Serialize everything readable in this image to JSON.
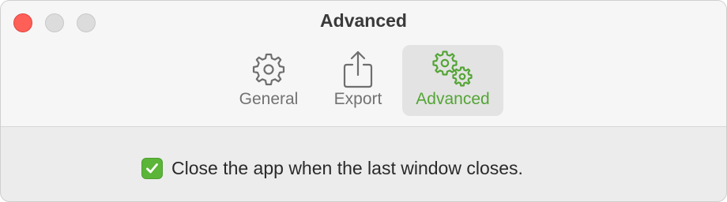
{
  "window": {
    "title": "Advanced"
  },
  "tabs": [
    {
      "label": "General",
      "icon": "gear-icon",
      "selected": false
    },
    {
      "label": "Export",
      "icon": "share-icon",
      "selected": false
    },
    {
      "label": "Advanced",
      "icon": "gears-icon",
      "selected": true
    }
  ],
  "settings": {
    "close_on_last_window": {
      "label": "Close the app when the last window closes.",
      "checked": true
    }
  },
  "colors": {
    "accent": "#53a535",
    "checkbox": "#5bb538",
    "close_button": "#fe5f57"
  }
}
